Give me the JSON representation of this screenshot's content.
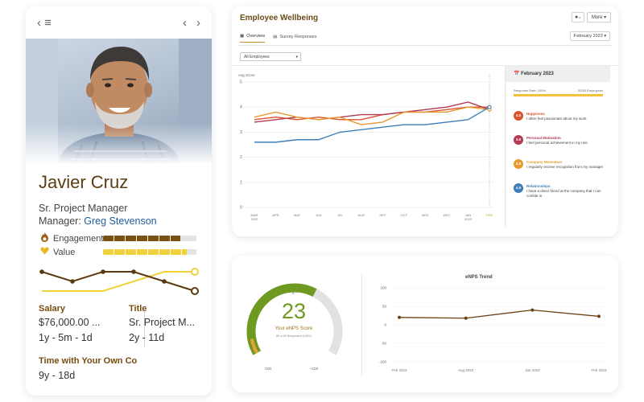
{
  "profile": {
    "name": "Javier Cruz",
    "title": "Sr. Project Manager",
    "manager_label": "Manager:",
    "manager_name": "Greg Stevenson",
    "metrics": [
      {
        "label": "Engagement",
        "icon": "flame-icon",
        "value": 0.83,
        "color": "#7a4f12"
      },
      {
        "label": "Value",
        "icon": "heart-icon",
        "value": 0.9,
        "color": "#f2d23a"
      }
    ],
    "stats": {
      "salary_label": "Salary",
      "salary_value": "$76,000.00 ...",
      "salary_tenure": "1y - 5m - 1d",
      "title_label": "Title",
      "title_value": "Sr. Project M...",
      "title_tenure": "2y - 11d",
      "company_label": "Time with Your Own Co",
      "company_tenure": "9y - 18d"
    }
  },
  "wellbeing": {
    "title": "Employee Wellbeing",
    "more_label": "More",
    "tabs": [
      {
        "label": "Overview",
        "active": true
      },
      {
        "label": "Survey Responses",
        "active": false
      }
    ],
    "period": "February 2023",
    "filter": "All Employees",
    "summary": {
      "heading": "February 2023",
      "response_rate_label": "Response Rate: 100%",
      "response_count": "53/53 Employees",
      "categories": [
        {
          "score": "4.0",
          "name": "Happiness",
          "statement": "I often feel passionate about my work",
          "color": "#d9532c"
        },
        {
          "score": "3.9",
          "name": "Personal Motivation",
          "statement": "I feel personal achievement in my role",
          "color": "#b23a54"
        },
        {
          "score": "3.9",
          "name": "Company Motivation",
          "statement": "I regularly receive recognition from my manager",
          "color": "#e89a2e"
        },
        {
          "score": "4.0",
          "name": "Relationships",
          "statement": "I have a direct friend at the company that I can confide in",
          "color": "#3d7fb8"
        }
      ]
    }
  },
  "chart_data": [
    {
      "type": "line",
      "ylabel": "Avg Score",
      "ylim": [
        0,
        5
      ],
      "yticks": [
        0,
        1,
        2,
        3,
        4,
        5
      ],
      "categories": [
        "MAR 2022",
        "APR",
        "MAY",
        "JUN",
        "JUL",
        "AUG",
        "SEP",
        "OCT",
        "NOV",
        "DEC",
        "JAN 2023",
        "FEB"
      ],
      "grid": true,
      "series": [
        {
          "color": "#d9532c",
          "values": [
            3.5,
            3.6,
            3.5,
            3.6,
            3.5,
            3.5,
            3.7,
            3.8,
            3.8,
            3.9,
            4.0,
            4.0
          ]
        },
        {
          "color": "#b23a54",
          "values": [
            3.4,
            3.5,
            3.6,
            3.5,
            3.6,
            3.7,
            3.7,
            3.8,
            3.9,
            4.0,
            4.2,
            3.9
          ]
        },
        {
          "color": "#e89a2e",
          "values": [
            3.6,
            3.8,
            3.6,
            3.5,
            3.6,
            3.3,
            3.4,
            3.8,
            3.8,
            3.8,
            4.0,
            3.9
          ]
        },
        {
          "color": "#3d7fb8",
          "values": [
            2.6,
            2.6,
            2.7,
            2.7,
            3.0,
            3.1,
            3.2,
            3.3,
            3.3,
            3.4,
            3.5,
            4.0
          ]
        }
      ]
    },
    {
      "type": "line",
      "title": "eNPS Trend",
      "ylim": [
        -100,
        100
      ],
      "yticks": [
        100,
        50,
        0,
        -50,
        -100
      ],
      "categories": [
        "Feb 2022",
        "Aug 2022",
        "Jan 2023",
        "Feb 2023"
      ],
      "grid": true,
      "series": [
        {
          "color": "#6b4213",
          "values": [
            20,
            18,
            40,
            23
          ]
        }
      ]
    }
  ],
  "profile_trend": {
    "engagement": [
      2,
      1,
      2,
      2,
      1,
      0
    ],
    "value": [
      0,
      0,
      0,
      1,
      2,
      2
    ],
    "colors": {
      "engagement": "#5c3a10",
      "value": "#f2d23a"
    }
  },
  "enps": {
    "score": "23",
    "label": "Your eNPS Score",
    "sub": "65 of 65 Responded (100%)",
    "min": "-100",
    "max": "+100",
    "zero": "0",
    "fill": 0.615,
    "color": "#6e9a22"
  }
}
